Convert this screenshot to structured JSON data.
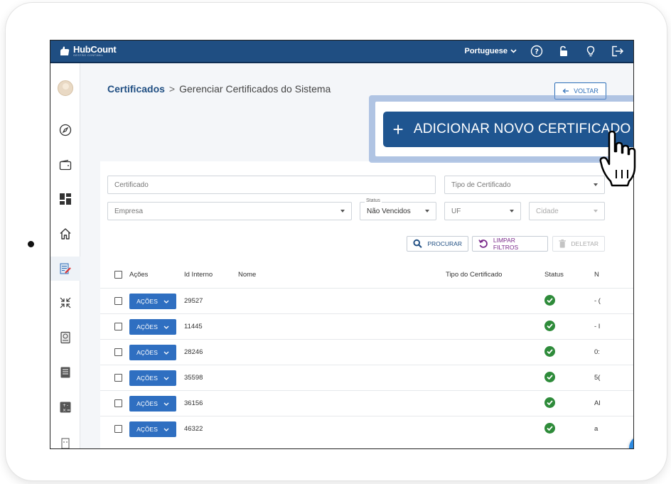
{
  "header": {
    "logo_text": "HubCount",
    "logo_subtitle": "GESTÃO CONTÁBIL",
    "language": "Portuguese"
  },
  "breadcrumb": {
    "parent": "Certificados",
    "separator": ">",
    "current": "Gerenciar Certificados do Sistema"
  },
  "buttons": {
    "back": "VOLTAR",
    "add_new": "ADICIONAR NOVO CERTIFICADO",
    "search": "PROCURAR",
    "clear_filters": "LIMPAR FILTROS",
    "delete": "DELETAR"
  },
  "filters": {
    "certificate_placeholder": "Certificado",
    "certificate_type_placeholder": "Tipo de Certificado",
    "company_placeholder": "Empresa",
    "status_label": "Status",
    "status_value": "Não Vencidos",
    "uf_placeholder": "UF",
    "city_placeholder": "Cidade"
  },
  "table": {
    "columns": [
      "Ações",
      "Id Interno",
      "Nome",
      "Tipo do Certificado",
      "Status",
      "N"
    ],
    "action_label": "AÇÕES",
    "rows": [
      {
        "id": "29527",
        "extra": "- ("
      },
      {
        "id": "11445",
        "extra": "- I"
      },
      {
        "id": "28246",
        "extra": "0:"
      },
      {
        "id": "35598",
        "extra": "5("
      },
      {
        "id": "36156",
        "extra": "Al"
      },
      {
        "id": "46322",
        "extra": "a"
      }
    ]
  },
  "colors": {
    "brand": "#1f4e82",
    "primary_button": "#1f5590",
    "action_button": "#2f6fc1",
    "status_ok": "#2e8b3a",
    "highlight": "#789bd2"
  }
}
